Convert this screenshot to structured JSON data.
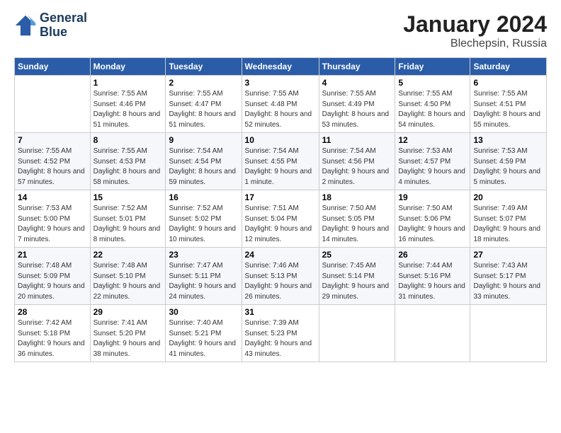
{
  "header": {
    "logo_line1": "General",
    "logo_line2": "Blue",
    "title": "January 2024",
    "subtitle": "Blechepsin, Russia"
  },
  "columns": [
    "Sunday",
    "Monday",
    "Tuesday",
    "Wednesday",
    "Thursday",
    "Friday",
    "Saturday"
  ],
  "weeks": [
    [
      {
        "day": "",
        "sunrise": "",
        "sunset": "",
        "daylight": ""
      },
      {
        "day": "1",
        "sunrise": "Sunrise: 7:55 AM",
        "sunset": "Sunset: 4:46 PM",
        "daylight": "Daylight: 8 hours and 51 minutes."
      },
      {
        "day": "2",
        "sunrise": "Sunrise: 7:55 AM",
        "sunset": "Sunset: 4:47 PM",
        "daylight": "Daylight: 8 hours and 51 minutes."
      },
      {
        "day": "3",
        "sunrise": "Sunrise: 7:55 AM",
        "sunset": "Sunset: 4:48 PM",
        "daylight": "Daylight: 8 hours and 52 minutes."
      },
      {
        "day": "4",
        "sunrise": "Sunrise: 7:55 AM",
        "sunset": "Sunset: 4:49 PM",
        "daylight": "Daylight: 8 hours and 53 minutes."
      },
      {
        "day": "5",
        "sunrise": "Sunrise: 7:55 AM",
        "sunset": "Sunset: 4:50 PM",
        "daylight": "Daylight: 8 hours and 54 minutes."
      },
      {
        "day": "6",
        "sunrise": "Sunrise: 7:55 AM",
        "sunset": "Sunset: 4:51 PM",
        "daylight": "Daylight: 8 hours and 55 minutes."
      }
    ],
    [
      {
        "day": "7",
        "sunrise": "Sunrise: 7:55 AM",
        "sunset": "Sunset: 4:52 PM",
        "daylight": "Daylight: 8 hours and 57 minutes."
      },
      {
        "day": "8",
        "sunrise": "Sunrise: 7:55 AM",
        "sunset": "Sunset: 4:53 PM",
        "daylight": "Daylight: 8 hours and 58 minutes."
      },
      {
        "day": "9",
        "sunrise": "Sunrise: 7:54 AM",
        "sunset": "Sunset: 4:54 PM",
        "daylight": "Daylight: 8 hours and 59 minutes."
      },
      {
        "day": "10",
        "sunrise": "Sunrise: 7:54 AM",
        "sunset": "Sunset: 4:55 PM",
        "daylight": "Daylight: 9 hours and 1 minute."
      },
      {
        "day": "11",
        "sunrise": "Sunrise: 7:54 AM",
        "sunset": "Sunset: 4:56 PM",
        "daylight": "Daylight: 9 hours and 2 minutes."
      },
      {
        "day": "12",
        "sunrise": "Sunrise: 7:53 AM",
        "sunset": "Sunset: 4:57 PM",
        "daylight": "Daylight: 9 hours and 4 minutes."
      },
      {
        "day": "13",
        "sunrise": "Sunrise: 7:53 AM",
        "sunset": "Sunset: 4:59 PM",
        "daylight": "Daylight: 9 hours and 5 minutes."
      }
    ],
    [
      {
        "day": "14",
        "sunrise": "Sunrise: 7:53 AM",
        "sunset": "Sunset: 5:00 PM",
        "daylight": "Daylight: 9 hours and 7 minutes."
      },
      {
        "day": "15",
        "sunrise": "Sunrise: 7:52 AM",
        "sunset": "Sunset: 5:01 PM",
        "daylight": "Daylight: 9 hours and 8 minutes."
      },
      {
        "day": "16",
        "sunrise": "Sunrise: 7:52 AM",
        "sunset": "Sunset: 5:02 PM",
        "daylight": "Daylight: 9 hours and 10 minutes."
      },
      {
        "day": "17",
        "sunrise": "Sunrise: 7:51 AM",
        "sunset": "Sunset: 5:04 PM",
        "daylight": "Daylight: 9 hours and 12 minutes."
      },
      {
        "day": "18",
        "sunrise": "Sunrise: 7:50 AM",
        "sunset": "Sunset: 5:05 PM",
        "daylight": "Daylight: 9 hours and 14 minutes."
      },
      {
        "day": "19",
        "sunrise": "Sunrise: 7:50 AM",
        "sunset": "Sunset: 5:06 PM",
        "daylight": "Daylight: 9 hours and 16 minutes."
      },
      {
        "day": "20",
        "sunrise": "Sunrise: 7:49 AM",
        "sunset": "Sunset: 5:07 PM",
        "daylight": "Daylight: 9 hours and 18 minutes."
      }
    ],
    [
      {
        "day": "21",
        "sunrise": "Sunrise: 7:48 AM",
        "sunset": "Sunset: 5:09 PM",
        "daylight": "Daylight: 9 hours and 20 minutes."
      },
      {
        "day": "22",
        "sunrise": "Sunrise: 7:48 AM",
        "sunset": "Sunset: 5:10 PM",
        "daylight": "Daylight: 9 hours and 22 minutes."
      },
      {
        "day": "23",
        "sunrise": "Sunrise: 7:47 AM",
        "sunset": "Sunset: 5:11 PM",
        "daylight": "Daylight: 9 hours and 24 minutes."
      },
      {
        "day": "24",
        "sunrise": "Sunrise: 7:46 AM",
        "sunset": "Sunset: 5:13 PM",
        "daylight": "Daylight: 9 hours and 26 minutes."
      },
      {
        "day": "25",
        "sunrise": "Sunrise: 7:45 AM",
        "sunset": "Sunset: 5:14 PM",
        "daylight": "Daylight: 9 hours and 29 minutes."
      },
      {
        "day": "26",
        "sunrise": "Sunrise: 7:44 AM",
        "sunset": "Sunset: 5:16 PM",
        "daylight": "Daylight: 9 hours and 31 minutes."
      },
      {
        "day": "27",
        "sunrise": "Sunrise: 7:43 AM",
        "sunset": "Sunset: 5:17 PM",
        "daylight": "Daylight: 9 hours and 33 minutes."
      }
    ],
    [
      {
        "day": "28",
        "sunrise": "Sunrise: 7:42 AM",
        "sunset": "Sunset: 5:18 PM",
        "daylight": "Daylight: 9 hours and 36 minutes."
      },
      {
        "day": "29",
        "sunrise": "Sunrise: 7:41 AM",
        "sunset": "Sunset: 5:20 PM",
        "daylight": "Daylight: 9 hours and 38 minutes."
      },
      {
        "day": "30",
        "sunrise": "Sunrise: 7:40 AM",
        "sunset": "Sunset: 5:21 PM",
        "daylight": "Daylight: 9 hours and 41 minutes."
      },
      {
        "day": "31",
        "sunrise": "Sunrise: 7:39 AM",
        "sunset": "Sunset: 5:23 PM",
        "daylight": "Daylight: 9 hours and 43 minutes."
      },
      {
        "day": "",
        "sunrise": "",
        "sunset": "",
        "daylight": ""
      },
      {
        "day": "",
        "sunrise": "",
        "sunset": "",
        "daylight": ""
      },
      {
        "day": "",
        "sunrise": "",
        "sunset": "",
        "daylight": ""
      }
    ]
  ]
}
